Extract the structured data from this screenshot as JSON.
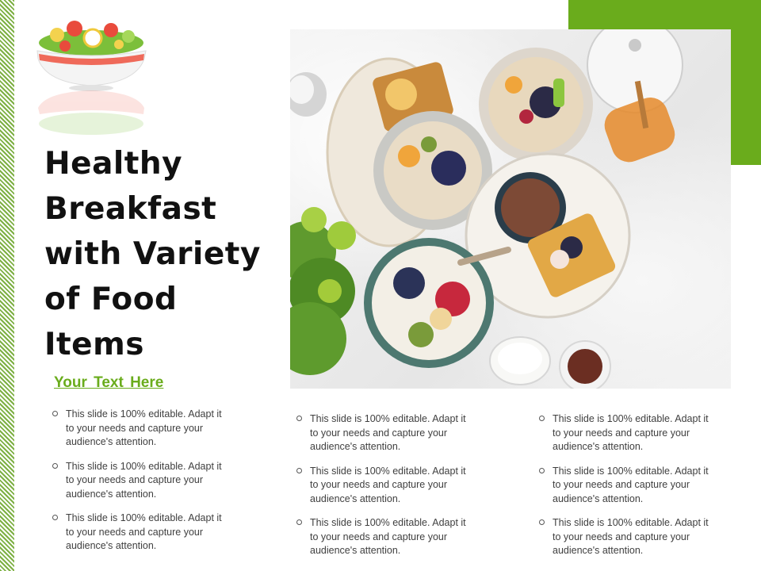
{
  "slide": {
    "title": "Healthy Breakfast with Variety of Food Items",
    "subheading": "Your  Text Here",
    "columns": [
      [
        "This slide is 100% editable. Adapt it to your needs and capture your audience's attention.",
        "This slide is 100% editable. Adapt it to your needs and capture your audience's attention.",
        "This slide is 100% editable. Adapt it to your needs and capture your audience's attention."
      ],
      [
        "This slide is 100% editable. Adapt it to your needs and capture your audience's attention.",
        "This slide is 100% editable. Adapt it to your needs and capture your audience's attention.",
        "This slide is 100% editable. Adapt it to your needs and capture your audience's attention."
      ],
      [
        "This slide is 100% editable. Adapt it to your needs and capture your audience's attention.",
        "This slide is 100% editable. Adapt it to your needs and capture your audience's attention.",
        "This slide is 100% editable. Adapt it to your needs and capture your audience's attention."
      ]
    ]
  },
  "colors": {
    "accent_green": "#6aac1c",
    "title_text": "#111111",
    "body_text": "#404040"
  },
  "icons": {
    "logo": "salad-bowl-icon",
    "bullet": "hollow-circle-bullet-icon"
  }
}
